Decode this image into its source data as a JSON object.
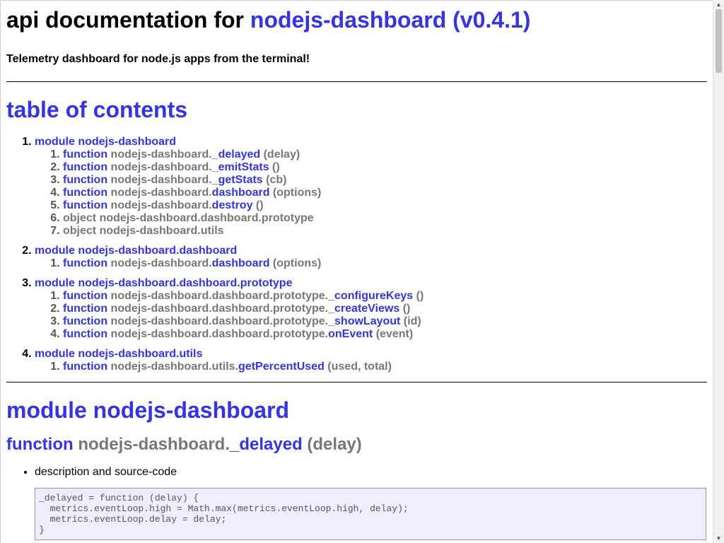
{
  "header": {
    "title_prefix": "api documentation for ",
    "title_link": "nodejs-dashboard (v0.4.1)",
    "description": "Telemetry dashboard for node.js apps from the terminal!"
  },
  "toc": {
    "title": "table of contents",
    "modules": [
      {
        "label": "module nodejs-dashboard",
        "items": [
          {
            "kw": "function",
            "ns": "nodejs-dashboard.",
            "name": "_delayed",
            "args": " (delay)"
          },
          {
            "kw": "function",
            "ns": "nodejs-dashboard.",
            "name": "_emitStats",
            "args": " ()"
          },
          {
            "kw": "function",
            "ns": "nodejs-dashboard.",
            "name": "_getStats",
            "args": " (cb)"
          },
          {
            "kw": "function",
            "ns": "nodejs-dashboard.",
            "name": "dashboard",
            "args": " (options)"
          },
          {
            "kw": "function",
            "ns": "nodejs-dashboard.",
            "name": "destroy",
            "args": " ()"
          },
          {
            "obj": "object nodejs-dashboard.dashboard.prototype"
          },
          {
            "obj": "object nodejs-dashboard.utils"
          }
        ]
      },
      {
        "label": "module nodejs-dashboard.dashboard",
        "items": [
          {
            "kw": "function",
            "ns": "nodejs-dashboard.",
            "name": "dashboard",
            "args": " (options)"
          }
        ]
      },
      {
        "label": "module nodejs-dashboard.dashboard.prototype",
        "items": [
          {
            "kw": "function",
            "ns": "nodejs-dashboard.dashboard.prototype.",
            "name": "_configureKeys",
            "args": " ()"
          },
          {
            "kw": "function",
            "ns": "nodejs-dashboard.dashboard.prototype.",
            "name": "_createViews",
            "args": " ()"
          },
          {
            "kw": "function",
            "ns": "nodejs-dashboard.dashboard.prototype.",
            "name": "_showLayout",
            "args": " (id)"
          },
          {
            "kw": "function",
            "ns": "nodejs-dashboard.dashboard.prototype.",
            "name": "onEvent",
            "args": " (event)"
          }
        ]
      },
      {
        "label": "module nodejs-dashboard.utils",
        "items": [
          {
            "kw": "function",
            "ns": "nodejs-dashboard.utils.",
            "name": "getPercentUsed",
            "args": " (used, total)"
          }
        ]
      }
    ]
  },
  "section": {
    "module_title": "module nodejs-dashboard",
    "function_heading": {
      "kw": "function",
      "ns": "nodejs-dashboard.",
      "name": "_delayed",
      "args": " (delay)"
    },
    "detail_label": "description and source-code",
    "code": "_delayed = function (delay) {\n  metrics.eventLoop.high = Math.max(metrics.eventLoop.high, delay);\n  metrics.eventLoop.delay = delay;\n}"
  }
}
